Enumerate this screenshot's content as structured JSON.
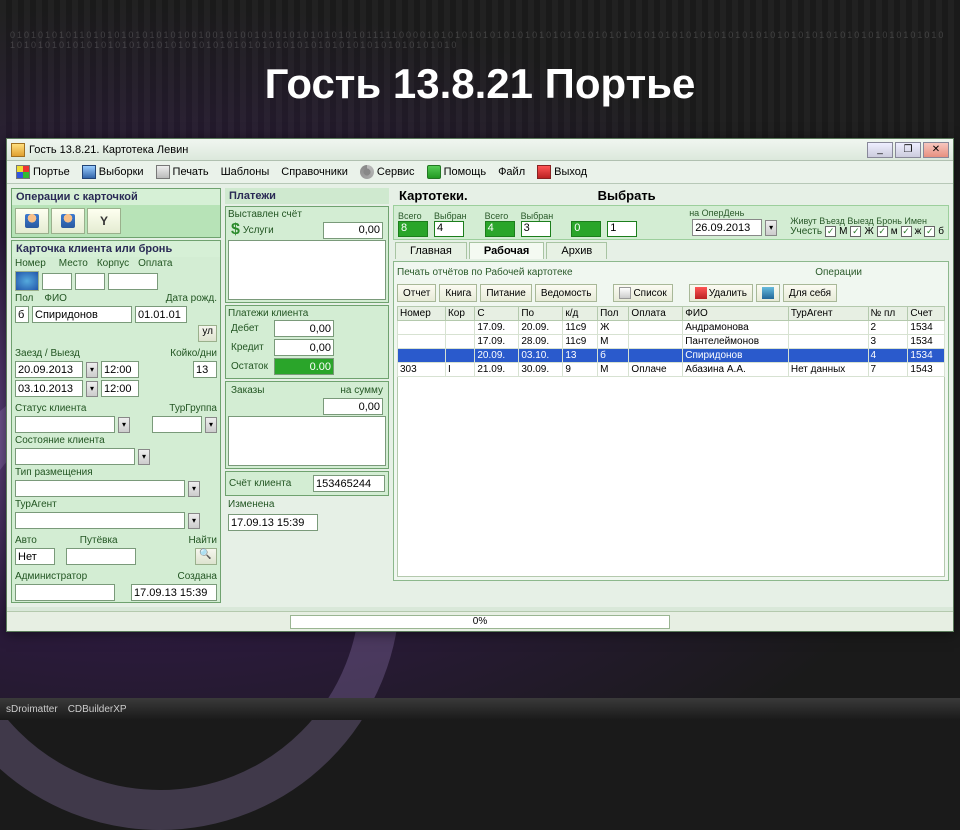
{
  "slide": {
    "title": "Гость 13.8.21 Портье"
  },
  "window": {
    "title": "Гость 13.8.21. Картотека Левин"
  },
  "menu": {
    "porter": "Портье",
    "select": "Выборки",
    "print": "Печать",
    "templates": "Шаблоны",
    "refs": "Справочники",
    "service": "Сервис",
    "help": "Помощь",
    "file": "Файл",
    "exit": "Выход"
  },
  "left": {
    "ops_card": "Операции с карточкой",
    "card_or_book": "Карточка клиента или бронь",
    "nomer": "Номер",
    "mesto": "Место",
    "korpus": "Корпус",
    "oplata": "Оплата",
    "pol": "Пол",
    "fio": "ФИО",
    "dob": "Дата рожд.",
    "pol_val": "б",
    "fio_val": "Спиридонов",
    "dob_val": "01.01.01",
    "ul": "ул",
    "zaezd": "Заезд / Выезд",
    "koiko": "Койко/дни",
    "date_in": "20.09.2013",
    "time_in": "12:00",
    "date_out": "03.10.2013",
    "time_out": "12:00",
    "koiko_val": "13",
    "status": "Статус клиента",
    "turgrp": "ТурГруппа",
    "sost": "Состояние клиента",
    "tip": "Тип размещения",
    "turagent": "ТурАгент",
    "avto": "Авто",
    "putevka": "Путёвка",
    "najti": "Найти",
    "avto_val": "Нет",
    "admin": "Администратор",
    "created": "Создана",
    "created_val": "17.09.13 15:39"
  },
  "mid": {
    "payments": "Платежи",
    "bill": "Выставлен счёт",
    "services": "Услуги",
    "services_val": "0,00",
    "client_pay": "Платежи клиента",
    "debet": "Дебет",
    "debet_val": "0,00",
    "credit": "Кредит",
    "credit_val": "0,00",
    "ostatok": "Остаток",
    "ostatok_val": "0.00",
    "orders": "Заказы",
    "orders_sum": "на сумму",
    "orders_val": "0,00",
    "account": "Счёт клиента",
    "account_val": "153465244",
    "changed": "Изменена",
    "changed_val": "17.09.13 15:39"
  },
  "right": {
    "annot1": "Картотеки.",
    "annot2": "Выбрать",
    "vsego": "Всего",
    "vybran": "Выбран",
    "c1a": "8",
    "c1b": "4",
    "c2a": "4",
    "c2b": "3",
    "c3a": "0",
    "c3b": "1",
    "operday": "на ОперДень",
    "operday_val": "26.09.2013",
    "filters": "Живут Въезд Выезд Бронь Имен",
    "uchest": "Учесть",
    "chk": {
      "M": "М",
      "Zh": "Ж",
      "m": "м",
      "zh": "ж",
      "b": "б"
    },
    "tabs": {
      "main": "Главная",
      "work": "Рабочая",
      "arch": "Архив"
    },
    "print_caption": "Печать отчётов по Рабочей картотеке",
    "ops_caption": "Операции",
    "btn": {
      "otchet": "Отчет",
      "kniga": "Книга",
      "pitanie": "Питание",
      "vedom": "Ведомость",
      "spisok": "Список",
      "udal": "Удалить",
      "dlyaseb": "Для себя"
    },
    "cols": {
      "nomer": "Номер",
      "kor": "Кор",
      "s": "С",
      "po": "По",
      "kd": "к/д",
      "pol": "Пол",
      "oplata": "Оплата",
      "fio": "ФИО",
      "turagent": "ТурАгент",
      "npl": "№ пл",
      "schet": "Счет"
    },
    "rows": [
      {
        "nomer": "",
        "kor": "",
        "s": "17.09.",
        "po": "20.09.",
        "kd": "11с9",
        "pol": "Ж",
        "oplata": "",
        "fio": "Андрамонова",
        "tur": "",
        "npl": "2",
        "schet": "1534"
      },
      {
        "nomer": "",
        "kor": "",
        "s": "17.09.",
        "po": "28.09.",
        "kd": "11с9",
        "pol": "М",
        "oplata": "",
        "fio": "Пантелеймонов",
        "tur": "",
        "npl": "3",
        "schet": "1534"
      },
      {
        "nomer": "",
        "kor": "",
        "s": "20.09.",
        "po": "03.10.",
        "kd": "13",
        "pol": "б",
        "oplata": "",
        "fio": "Спиридонов",
        "tur": "",
        "npl": "4",
        "schet": "1534",
        "sel": true
      },
      {
        "nomer": "303",
        "kor": "І",
        "s": "21.09.",
        "po": "30.09.",
        "kd": "9",
        "pol": "М",
        "oplata": "Оплаче",
        "fio": "Абазина А.А.",
        "tur": "Нет данных",
        "npl": "7",
        "schet": "1543"
      }
    ],
    "progress": "0%"
  },
  "taskbar": {
    "a": "sDroimatter",
    "b": "CDBuilderXP"
  }
}
